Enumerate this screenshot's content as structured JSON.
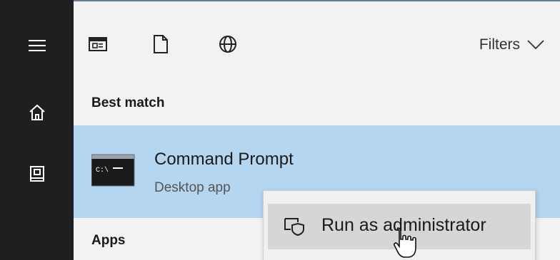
{
  "filterbar": {
    "filters_label": "Filters",
    "icons": {
      "apps": "apps-filter-icon",
      "documents": "document-filter-icon",
      "web": "globe-icon",
      "chevron": "chevron-down-icon"
    }
  },
  "sidebar": {
    "icons": [
      "hamburger-menu-icon",
      "home-icon",
      "documents-icon"
    ]
  },
  "results": {
    "best_match_header": "Best match",
    "best_match": {
      "title": "Command Prompt",
      "subtitle": "Desktop app",
      "icon": "command-prompt-icon"
    },
    "apps_header": "Apps"
  },
  "context_menu": {
    "items": [
      {
        "label": "Run as administrator",
        "icon": "run-as-admin-shield-icon"
      }
    ]
  },
  "colors": {
    "rail_background": "#1f1f1f",
    "panel_background": "#f2f2f2",
    "selected_result": "#b4d6f1",
    "context_menu_hover": "#d6d6d6"
  }
}
